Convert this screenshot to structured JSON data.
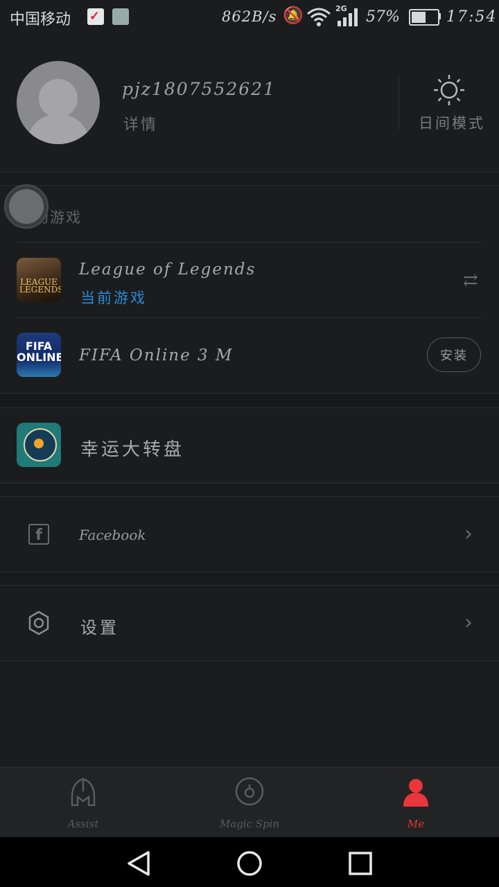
{
  "status_bar": {
    "carrier": "中国移动",
    "network_speed": "862B/s",
    "network_type": "2G",
    "battery": "57%",
    "time": "17:54"
  },
  "profile": {
    "username": "pjz1807552621",
    "details_label": "详情",
    "mode_label": "日间模式",
    "mode_icon": "sun-icon"
  },
  "my_games": {
    "header": "我的游戏",
    "games": [
      {
        "title": "League of Legends",
        "subtitle": "当前游戏",
        "icon_text": "LEAGUE LEGENDS",
        "action_icon": "swap-icon"
      },
      {
        "title": "FIFA Online 3 M",
        "icon_text": "FIFA ONLINE3",
        "action_label": "安装"
      }
    ]
  },
  "lucky_wheel": {
    "label": "幸运大转盘",
    "icon": "spin-wheel-icon"
  },
  "menu": [
    {
      "label": "Facebook",
      "icon": "facebook-icon"
    },
    {
      "label": "设置",
      "icon": "gear-icon"
    }
  ],
  "tabs": [
    {
      "label": "Assist",
      "icon": "helmet-icon",
      "active": false
    },
    {
      "label": "Magic Spin",
      "icon": "spin-icon",
      "active": false
    },
    {
      "label": "Me",
      "icon": "person-icon",
      "active": true
    }
  ],
  "colors": {
    "background": "#1b1c1e",
    "accent": "#e8363a",
    "link_blue": "#2a8ad8"
  }
}
